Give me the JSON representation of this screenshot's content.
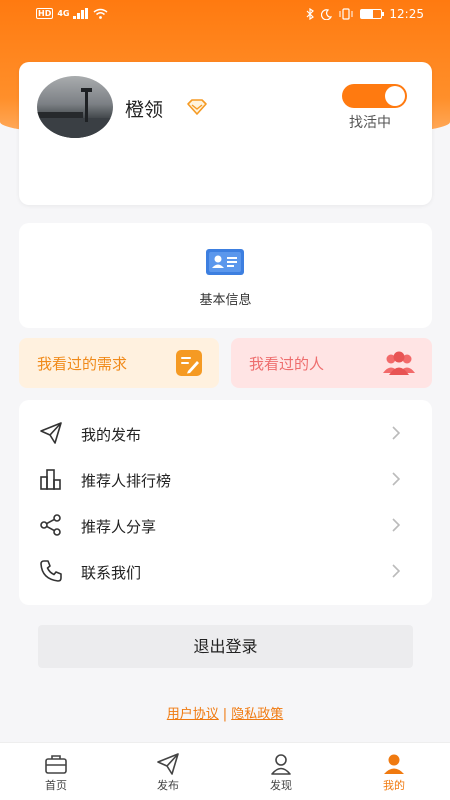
{
  "status_bar": {
    "network_badge": "HD",
    "signal_badge": "4G",
    "time": "12:25",
    "battery_level": 0.6
  },
  "profile": {
    "name": "橙领",
    "status_label": "找活中",
    "status_on": true,
    "accent_color": "#ff7a10"
  },
  "basic_info": {
    "label": "基本信息",
    "icon": "id-card-icon"
  },
  "history": {
    "demands_label": "我看过的需求",
    "people_label": "我看过的人"
  },
  "menu": {
    "items": [
      {
        "label": "我的发布",
        "icon": "paper-plane-icon"
      },
      {
        "label": "推荐人排行榜",
        "icon": "bar-chart-icon"
      },
      {
        "label": "推荐人分享",
        "icon": "share-icon"
      },
      {
        "label": "联系我们",
        "icon": "phone-icon"
      }
    ]
  },
  "logout_label": "退出登录",
  "legal": {
    "user_agreement": "用户协议",
    "separator": "|",
    "privacy_policy": "隐私政策"
  },
  "tabs": [
    {
      "label": "首页",
      "icon": "briefcase-icon",
      "active": false
    },
    {
      "label": "发布",
      "icon": "paper-plane-icon",
      "active": false
    },
    {
      "label": "发现",
      "icon": "person-search-icon",
      "active": false
    },
    {
      "label": "我的",
      "icon": "person-icon",
      "active": true
    }
  ]
}
